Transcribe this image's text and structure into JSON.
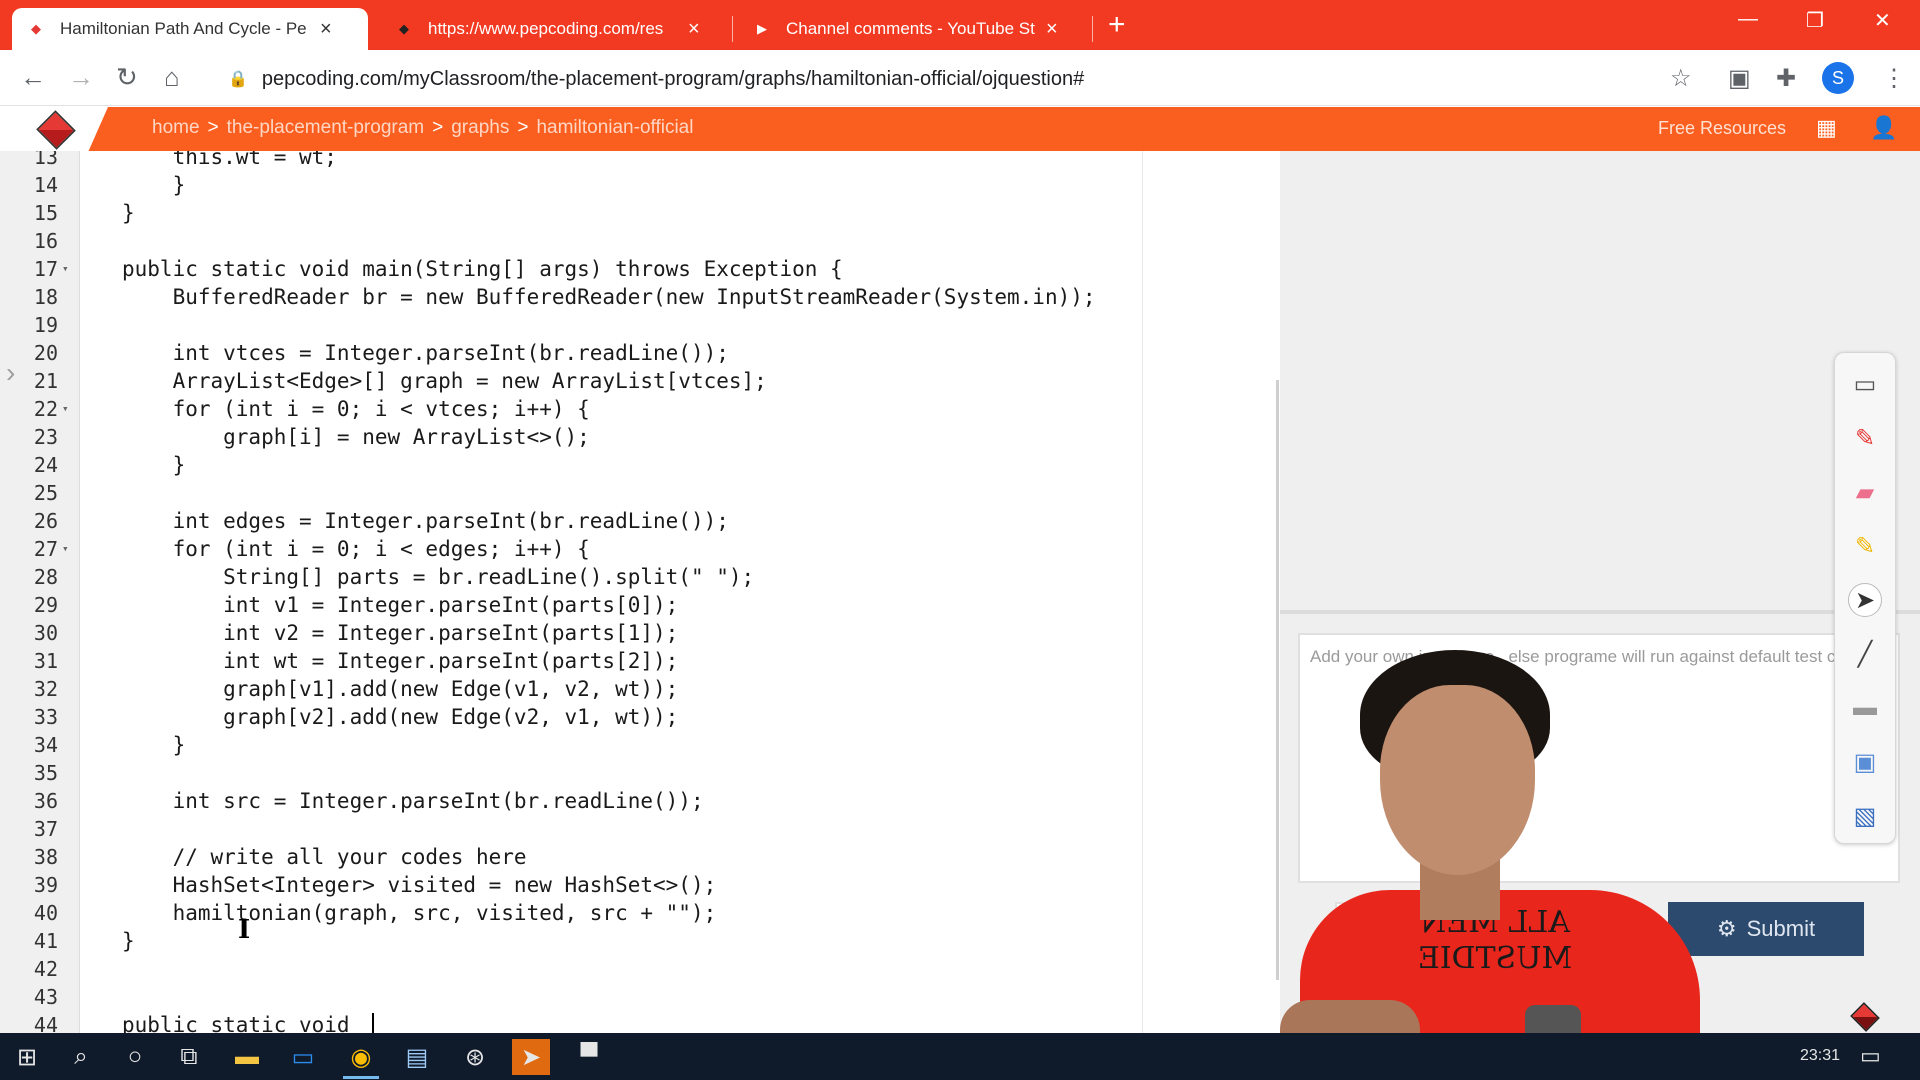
{
  "browser": {
    "tabs": [
      {
        "title": "Hamiltonian Path And Cycle - Pe",
        "active": true
      },
      {
        "title": "https://www.pepcoding.com/res",
        "active": false
      },
      {
        "title": "Channel comments - YouTube St",
        "active": false
      }
    ],
    "new_tab": "+",
    "url": "pepcoding.com/myClassroom/the-placement-program/graphs/hamiltonian-official/ojquestion#",
    "profile_initial": "S"
  },
  "site": {
    "breadcrumb": [
      "home",
      "the-placement-program",
      "graphs",
      "hamiltonian-official"
    ],
    "breadcrumb_sep": ">",
    "free_resources": "Free Resources",
    "accent_color": "#fb5f1f"
  },
  "editor": {
    "lines": [
      {
        "n": "13",
        "text": "    this.wt = wt;"
      },
      {
        "n": "14",
        "text": "    }"
      },
      {
        "n": "15",
        "text": "}"
      },
      {
        "n": "16",
        "text": ""
      },
      {
        "n": "17",
        "text": "public static void main(String[] args) throws Exception {"
      },
      {
        "n": "18",
        "text": "    BufferedReader br = new BufferedReader(new InputStreamReader(System.in));"
      },
      {
        "n": "19",
        "text": ""
      },
      {
        "n": "20",
        "text": "    int vtces = Integer.parseInt(br.readLine());"
      },
      {
        "n": "21",
        "text": "    ArrayList<Edge>[] graph = new ArrayList[vtces];"
      },
      {
        "n": "22",
        "text": "    for (int i = 0; i < vtces; i++) {"
      },
      {
        "n": "23",
        "text": "        graph[i] = new ArrayList<>();"
      },
      {
        "n": "24",
        "text": "    }"
      },
      {
        "n": "25",
        "text": ""
      },
      {
        "n": "26",
        "text": "    int edges = Integer.parseInt(br.readLine());"
      },
      {
        "n": "27",
        "text": "    for (int i = 0; i < edges; i++) {"
      },
      {
        "n": "28",
        "text": "        String[] parts = br.readLine().split(\" \");"
      },
      {
        "n": "29",
        "text": "        int v1 = Integer.parseInt(parts[0]);"
      },
      {
        "n": "30",
        "text": "        int v2 = Integer.parseInt(parts[1]);"
      },
      {
        "n": "31",
        "text": "        int wt = Integer.parseInt(parts[2]);"
      },
      {
        "n": "32",
        "text": "        graph[v1].add(new Edge(v1, v2, wt));"
      },
      {
        "n": "33",
        "text": "        graph[v2].add(new Edge(v2, v1, wt));"
      },
      {
        "n": "34",
        "text": "    }"
      },
      {
        "n": "35",
        "text": ""
      },
      {
        "n": "36",
        "text": "    int src = Integer.parseInt(br.readLine());"
      },
      {
        "n": "37",
        "text": ""
      },
      {
        "n": "38",
        "text": "    // write all your codes here"
      },
      {
        "n": "39",
        "text": "    HashSet<Integer> visited = new HashSet<>();"
      },
      {
        "n": "40",
        "text": "    hamiltonian(graph, src, visited, src + \"\");"
      },
      {
        "n": "41",
        "text": "}"
      },
      {
        "n": "42",
        "text": ""
      },
      {
        "n": "43",
        "text": ""
      },
      {
        "n": "44",
        "text": "public static void "
      }
    ]
  },
  "panel": {
    "input_placeholder": "Add your own input here , else programe will run against default test case",
    "submit_label": "Submit"
  },
  "webcam": {
    "shirt_text": "ALL MEN MUSTDIE"
  },
  "taskbar": {
    "clock": "23:31"
  }
}
